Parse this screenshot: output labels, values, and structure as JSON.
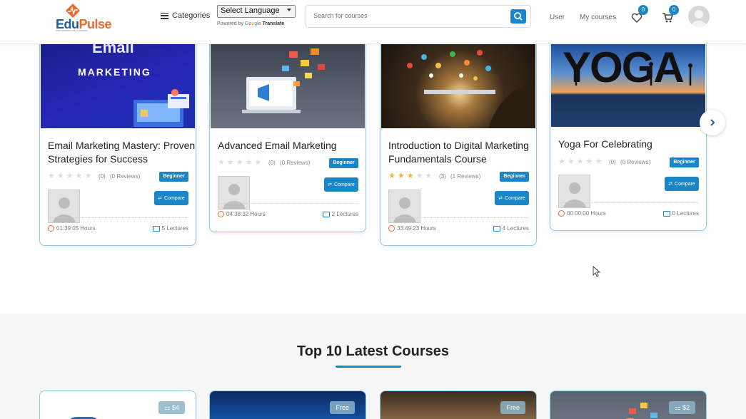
{
  "header": {
    "logo_edu": "Edu",
    "logo_pulse": "Pulse",
    "logo_tagline": "EMPOWERING THE LEARNERS",
    "categories_label": "Categories",
    "language_select": "Select Language",
    "powered_by": "Powered by",
    "google": [
      "G",
      "o",
      "o",
      "g",
      "l",
      "e"
    ],
    "translate": "Translate",
    "search_placeholder": "Search for courses",
    "user_link": "User",
    "my_courses_link": "My courses",
    "wishlist_count": "0",
    "cart_count": "0"
  },
  "courses": [
    {
      "image_text_1": "Email",
      "image_text_2": "MARKETING",
      "title_line_1": "Email Marketing Mastery: Proven",
      "title_line_2": "Strategies for Success",
      "rating": 0,
      "rating_count": "(0)",
      "reviews": "(0 Reviews)",
      "level": "Beginner",
      "compare": "Compare",
      "hours": "01:39:05 Hours",
      "lectures": "5 Lectures"
    },
    {
      "title_line_1": "Advanced Email Marketing",
      "title_line_2": "",
      "rating": 0,
      "rating_count": "(0)",
      "reviews": "(0 Reviews)",
      "level": "Beginner",
      "compare": "Compare",
      "hours": "04:38:32 Hours",
      "lectures": "2 Lectures"
    },
    {
      "title_line_1": "Introduction to Digital Marketing",
      "title_line_2": "Fundamentals Course",
      "rating": 3,
      "rating_count": "(3)",
      "reviews": "(1 Reviews)",
      "level": "Beginner",
      "compare": "Compare",
      "hours": "33:49:23 Hours",
      "lectures": "4 Lectures"
    },
    {
      "image_text_1": "YOGA",
      "title_line_1": "Yoga For Celebrating",
      "title_line_2": "",
      "rating": 0,
      "rating_count": "(0)",
      "reviews": "(0 Reviews)",
      "level": "Beginner",
      "compare": "Compare",
      "hours": "00:00:00 Hours",
      "lectures": "0 Lectures"
    }
  ],
  "latest": {
    "title": "Top 10 Latest Courses",
    "prices": [
      "$4",
      "Free",
      "Free",
      "$2"
    ]
  },
  "colors": {
    "accent": "#1a86c8",
    "brand_orange": "#ec6a2c",
    "brand_blue": "#1d5fa6",
    "card_border": "#8ecbe8",
    "star": "#f0b23a"
  }
}
